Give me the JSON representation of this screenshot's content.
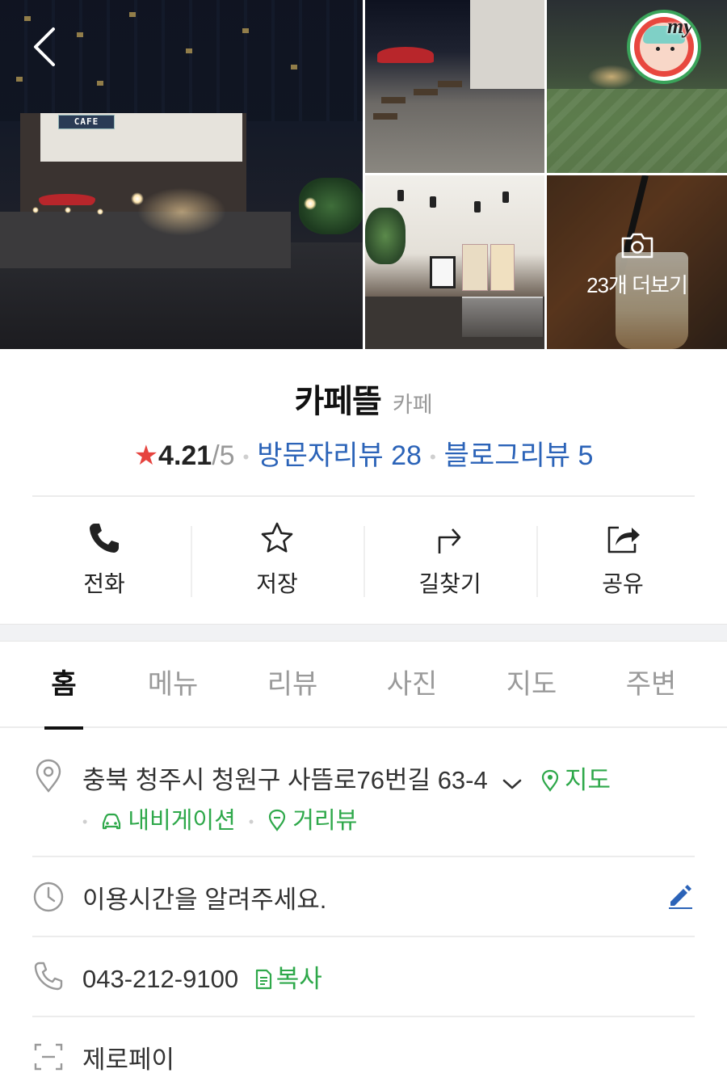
{
  "gallery": {
    "main_sign": "CAFE",
    "more_label": "23개 더보기"
  },
  "header": {
    "name": "카페뜰",
    "category": "카페",
    "rating_score": "4.21",
    "rating_outof": "/5",
    "visitor_reviews": "방문자리뷰 28",
    "blog_reviews": "블로그리뷰 5",
    "accent_star": "#e6433e",
    "link_color": "#2b63b8"
  },
  "avatar": {
    "label": "my"
  },
  "actions": [
    {
      "label": "전화",
      "icon": "phone-icon"
    },
    {
      "label": "저장",
      "icon": "star-icon"
    },
    {
      "label": "길찾기",
      "icon": "directions-icon"
    },
    {
      "label": "공유",
      "icon": "share-icon"
    }
  ],
  "tabs": [
    {
      "label": "홈",
      "active": true
    },
    {
      "label": "메뉴"
    },
    {
      "label": "리뷰"
    },
    {
      "label": "사진"
    },
    {
      "label": "지도"
    },
    {
      "label": "주변"
    }
  ],
  "info": {
    "address": "충북 청주시 청원구 사뜸로76번길 63-4",
    "map_link": "지도",
    "navigation_link": "내비게이션",
    "street_view_link": "거리뷰",
    "hours_prompt": "이용시간을 알려주세요.",
    "phone": "043-212-9100",
    "copy_link": "복사",
    "zeropay": "제로페이",
    "green_color": "#2ea84a"
  }
}
